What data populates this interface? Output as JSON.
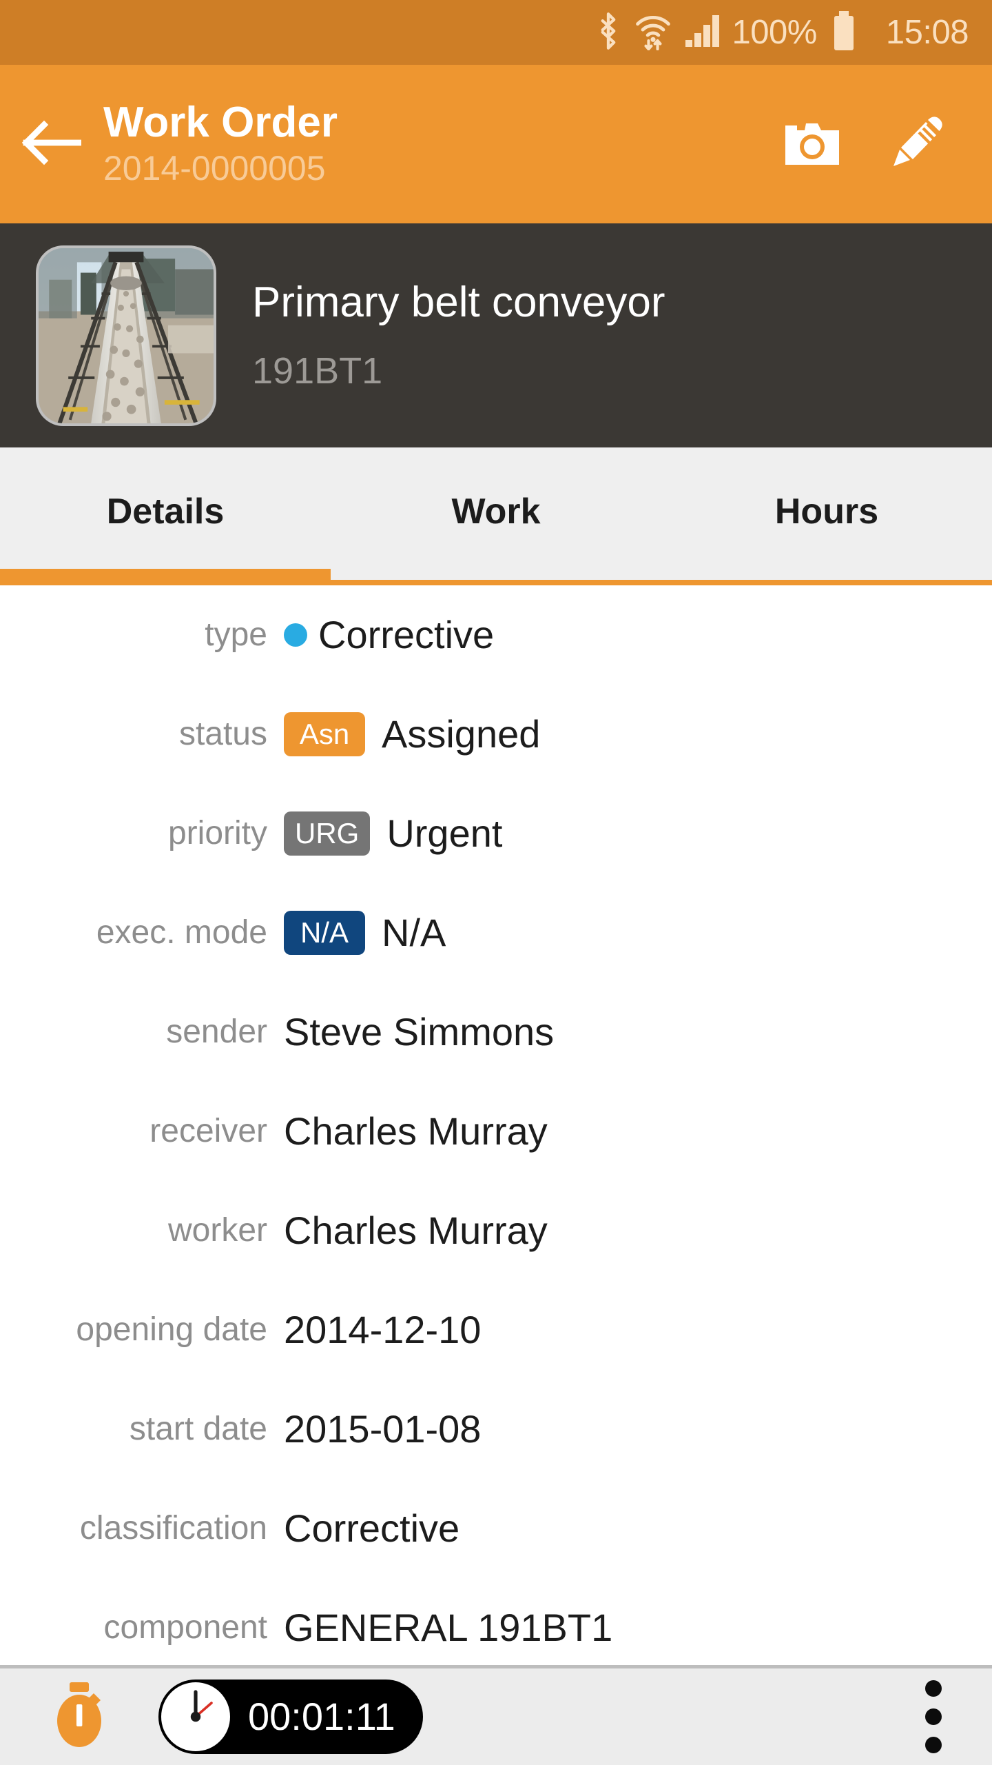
{
  "status_bar": {
    "battery_percent": "100%",
    "clock": "15:08",
    "icons": [
      "bluetooth-icon",
      "wifi-icon",
      "cellular-signal-icon",
      "battery-icon"
    ]
  },
  "app_bar": {
    "back_icon": "back-arrow-icon",
    "title": "Work Order",
    "subtitle": "2014-0000005",
    "actions": [
      {
        "name": "camera-icon",
        "label": "Camera"
      },
      {
        "name": "edit-pencil-icon",
        "label": "Edit"
      }
    ]
  },
  "asset": {
    "thumbnail_name": "conveyor-photo-thumbnail",
    "name": "Primary belt conveyor",
    "code": "191BT1"
  },
  "tabs": {
    "items": [
      {
        "label": "Details",
        "active": true
      },
      {
        "label": "Work",
        "active": false
      },
      {
        "label": "Hours",
        "active": false
      }
    ],
    "active_index": 0
  },
  "details": {
    "rows": [
      {
        "label": "type",
        "value": "Corrective",
        "marker": "dot",
        "marker_color": "#29abe2",
        "badge": null
      },
      {
        "label": "status",
        "value": "Assigned",
        "marker": "badge",
        "badge": "Asn",
        "badge_color": "#ee9630"
      },
      {
        "label": "priority",
        "value": "Urgent",
        "marker": "badge",
        "badge": "URG",
        "badge_color": "#757575"
      },
      {
        "label": "exec. mode",
        "value": "N/A",
        "marker": "badge",
        "badge": "N/A",
        "badge_color": "#10467e"
      },
      {
        "label": "sender",
        "value": "Steve Simmons",
        "marker": "none",
        "badge": null
      },
      {
        "label": "receiver",
        "value": "Charles Murray",
        "marker": "none",
        "badge": null
      },
      {
        "label": "worker",
        "value": "Charles Murray",
        "marker": "none",
        "badge": null
      },
      {
        "label": "opening date",
        "value": "2014-12-10",
        "marker": "none",
        "badge": null
      },
      {
        "label": "start date",
        "value": "2015-01-08",
        "marker": "none",
        "badge": null
      },
      {
        "label": "classification",
        "value": "Corrective",
        "marker": "none",
        "badge": null
      },
      {
        "label": "component",
        "value": "GENERAL 191BT1",
        "marker": "none",
        "badge": null
      }
    ]
  },
  "bottom_bar": {
    "stopwatch_icon": "stopwatch-icon",
    "timer_icon": "clock-face-icon",
    "timer_value": "00:01:11",
    "overflow_icon": "overflow-menu-icon"
  },
  "colors": {
    "status_bar": "#ce7e26",
    "app_bar": "#ee9630",
    "asset_header": "#3b3834",
    "tab_bar": "#efefef",
    "accent": "#ee9630",
    "type_dot": "#29abe2",
    "bottom_bar": "#ececec"
  }
}
